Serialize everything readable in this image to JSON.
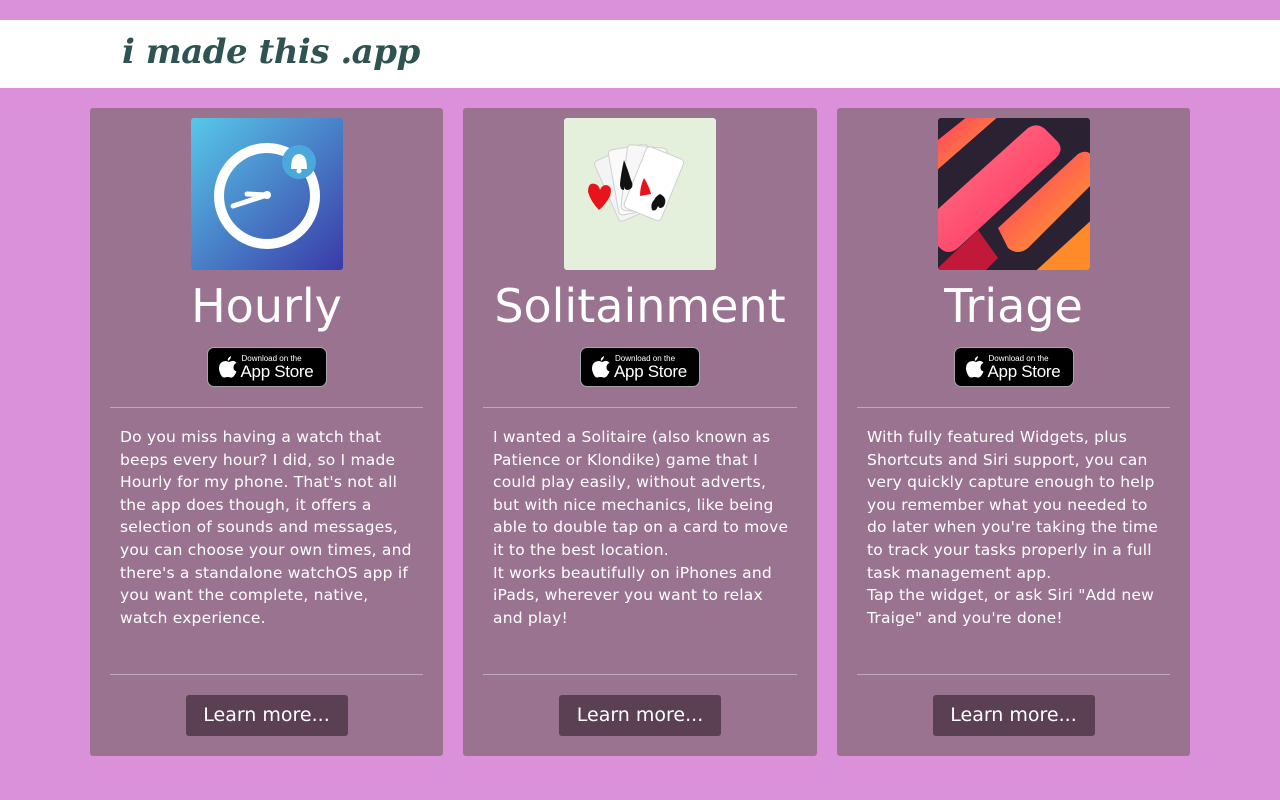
{
  "site": {
    "title": "i made this .app"
  },
  "apps": [
    {
      "name": "Hourly",
      "badge": {
        "small": "Download on the",
        "big": "App Store"
      },
      "description": [
        "Do you miss having a watch that beeps every hour? I did, so I made Hourly for my phone. That's not all the app does though, it offers a selection of sounds and messages, you can choose your own times, and there's a standalone watchOS app if you want the complete, native, watch experience."
      ],
      "button": "Learn more..."
    },
    {
      "name": "Solitainment",
      "badge": {
        "small": "Download on the",
        "big": "App Store"
      },
      "description": [
        "I wanted a Solitaire (also known as Patience or Klondike) game that I could play easily, without adverts, but with nice mechanics, like being able to double tap on a card to move it to the best location.",
        "It works beautifully on iPhones and iPads, wherever you want to relax and play!"
      ],
      "button": "Learn more..."
    },
    {
      "name": "Triage",
      "badge": {
        "small": "Download on the",
        "big": "App Store"
      },
      "description": [
        "With fully featured Widgets, plus Shortcuts and Siri support, you can very quickly capture enough to help you remember what you needed to do later when you're taking the time to track your tasks properly in a full task management app.",
        "Tap the widget, or ask Siri \"Add new Traige\" and you're done!"
      ],
      "button": "Learn more..."
    }
  ],
  "icons": [
    "hourly-app-icon",
    "solitainment-app-icon",
    "triage-app-icon",
    "apple-logo-icon"
  ],
  "colors": {
    "background": "#da91da",
    "header": "#ffffff",
    "title": "#2f5350",
    "card": "#9a7390",
    "button": "#5a4052"
  }
}
